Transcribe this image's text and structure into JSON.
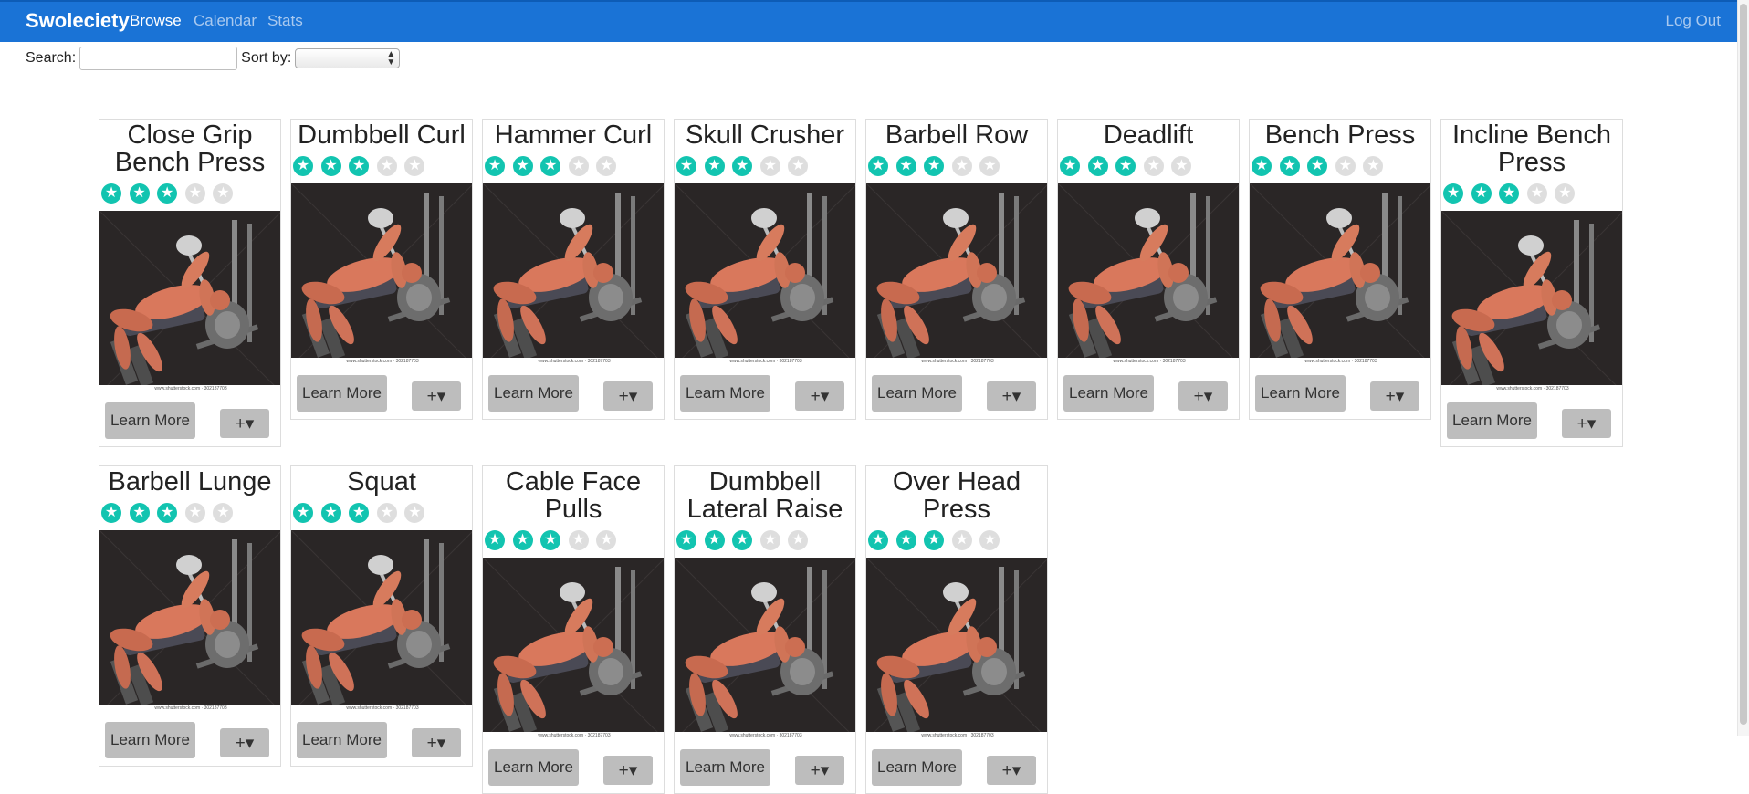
{
  "nav": {
    "brand": "Swoleciety",
    "links": [
      "Browse",
      "Calendar",
      "Stats"
    ],
    "logout": "Log Out"
  },
  "toolbar": {
    "search_label": "Search:",
    "search_value": "",
    "sort_label": "Sort by:",
    "sort_value": ""
  },
  "card_labels": {
    "learn_more": "Learn More",
    "add_button": "+▾"
  },
  "image_caption": "www.shutterstock.com · 302187703",
  "colors": {
    "navbar": "#1a73d6",
    "star_on": "#12c4b0",
    "star_off": "#dedede",
    "button": "#bdbdbd"
  },
  "exercises": [
    {
      "name": "Close Grip Bench Press",
      "rating": 3
    },
    {
      "name": "Dumbbell Curl",
      "rating": 3
    },
    {
      "name": "Hammer Curl",
      "rating": 3
    },
    {
      "name": "Skull Crusher",
      "rating": 3
    },
    {
      "name": "Barbell Row",
      "rating": 3
    },
    {
      "name": "Deadlift",
      "rating": 3
    },
    {
      "name": "Bench Press",
      "rating": 3
    },
    {
      "name": "Incline Bench Press",
      "rating": 3
    },
    {
      "name": "Barbell Lunge",
      "rating": 3
    },
    {
      "name": "Squat",
      "rating": 3
    },
    {
      "name": "Cable Face Pulls",
      "rating": 3
    },
    {
      "name": "Dumbbell Lateral Raise",
      "rating": 3
    },
    {
      "name": "Over Head Press",
      "rating": 3
    }
  ]
}
